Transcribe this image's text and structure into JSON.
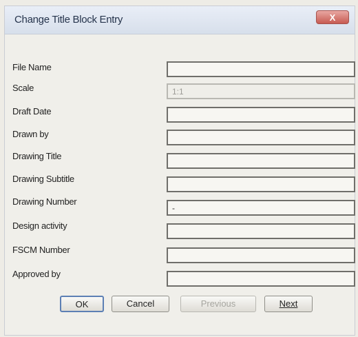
{
  "dialog": {
    "title": "Change Title Block Entry",
    "close_symbol": "X"
  },
  "fields": [
    {
      "label": "File Name",
      "value": ""
    },
    {
      "label": "Scale",
      "value": "1:1",
      "disabled": true
    },
    {
      "label": "Draft Date",
      "value": ""
    },
    {
      "label": "Drawn by",
      "value": ""
    },
    {
      "label": "Drawing Title",
      "value": ""
    },
    {
      "label": "Drawing Subtitle",
      "value": ""
    },
    {
      "label": "Drawing Number",
      "value": "-"
    },
    {
      "label": "Design activity",
      "value": ""
    },
    {
      "label": "FSCM Number",
      "value": ""
    },
    {
      "label": "Approved by",
      "value": ""
    }
  ],
  "buttons": {
    "ok": "OK",
    "cancel": "Cancel",
    "previous": "Previous",
    "next": "Next"
  }
}
